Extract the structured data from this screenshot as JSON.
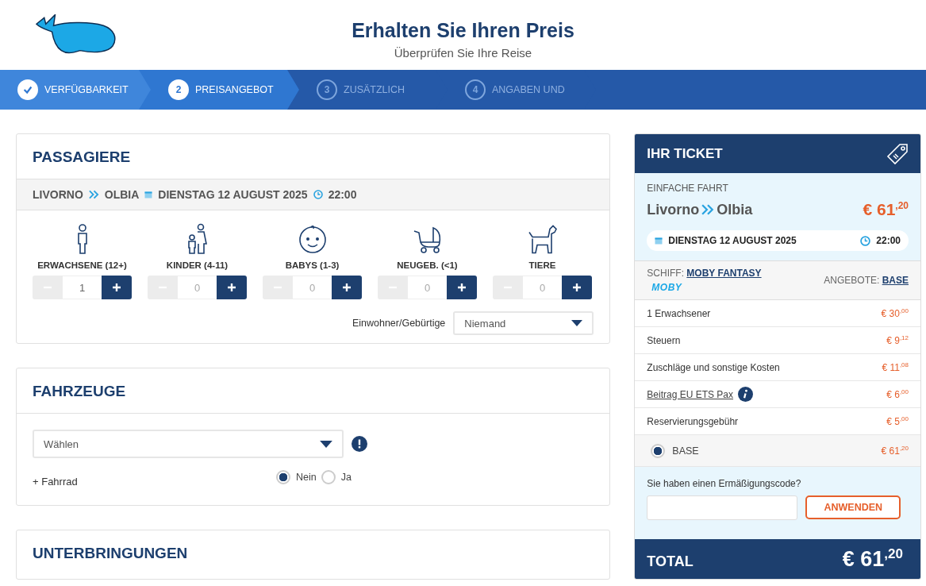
{
  "header": {
    "title": "Erhalten Sie Ihren Preis",
    "subtitle": "Überprüfen Sie Ihre Reise"
  },
  "steps": [
    {
      "kind": "done",
      "label": "VERFÜGBARKEIT",
      "selected": false
    },
    {
      "kind": "current",
      "number": "2",
      "label": "PREISANGEBOT",
      "selected": true
    },
    {
      "kind": "todo",
      "number": "3",
      "label": "ZUSÄTZLICH",
      "selected": false
    },
    {
      "kind": "todo",
      "number": "4",
      "label": "ANGABEN UND",
      "selected": false
    }
  ],
  "passengers": {
    "title": "PASSAGIERE",
    "route": {
      "from": "LIVORNO",
      "to": "OLBIA",
      "date": "DIENSTAG 12 AUGUST 2025",
      "time": "22:00"
    },
    "types": [
      {
        "kind": "adult",
        "label": "ERWACHSENE (12+)",
        "value": "1"
      },
      {
        "kind": "child",
        "label": "KINDER (4-11)",
        "value": "0"
      },
      {
        "kind": "baby",
        "label": "BABYS (1-3)",
        "value": "0"
      },
      {
        "kind": "newborn",
        "label": "NEUGEB. (<1)",
        "value": "0"
      },
      {
        "kind": "pet",
        "label": "TIERE",
        "value": "0"
      }
    ],
    "residents": {
      "label": "Einwohner/Gebürtige",
      "value": "Niemand"
    }
  },
  "vehicles": {
    "title": "FAHRZEUGE",
    "select": "Wählen",
    "bike": {
      "label": "+ Fahrrad",
      "options": [
        {
          "label": "Nein",
          "selected": true
        },
        {
          "label": "Ja",
          "selected": false
        }
      ]
    }
  },
  "accommodations": {
    "title": "UNTERBRINGUNGEN"
  },
  "ticket": {
    "title": "IHR TICKET",
    "trip_type": "EINFACHE FAHRT",
    "from": "Livorno",
    "to": "Olbia",
    "price": "€ 61$^{,20}$",
    "date": "DIENSTAG 12 AUGUST 2025",
    "time": "22:00",
    "ship_label": "SCHIFF:",
    "ship": "MOBY FANTASY",
    "brand": "MOBY",
    "offer_label": "ANGEBOTE:",
    "offer": "BASE",
    "lines": [
      {
        "kind": "plain",
        "label": "1 Erwachsener",
        "price": "€ 30$^{,00}$"
      },
      {
        "kind": "plain",
        "label": "Steuern",
        "price": "€ 9$^{,12}$"
      },
      {
        "kind": "plain",
        "label": "Zuschläge und sonstige Kosten",
        "price": "€ 11$^{,08}$"
      },
      {
        "kind": "link",
        "label": "Beitrag EU ETS Pax",
        "price": "€ 6$^{,00}$"
      },
      {
        "kind": "plain",
        "label": "Reservierungsgebühr",
        "price": "€ 5$^{,00}$"
      },
      {
        "kind": "radio",
        "label": "BASE",
        "price": "€ 61$^{,20}$",
        "selected": true
      }
    ],
    "discount": {
      "question": "Sie haben einen Ermäßigungscode?",
      "button": "ANWENDEN"
    },
    "total_label": "TOTAL",
    "total": "€ 61$^{,20}$"
  }
}
